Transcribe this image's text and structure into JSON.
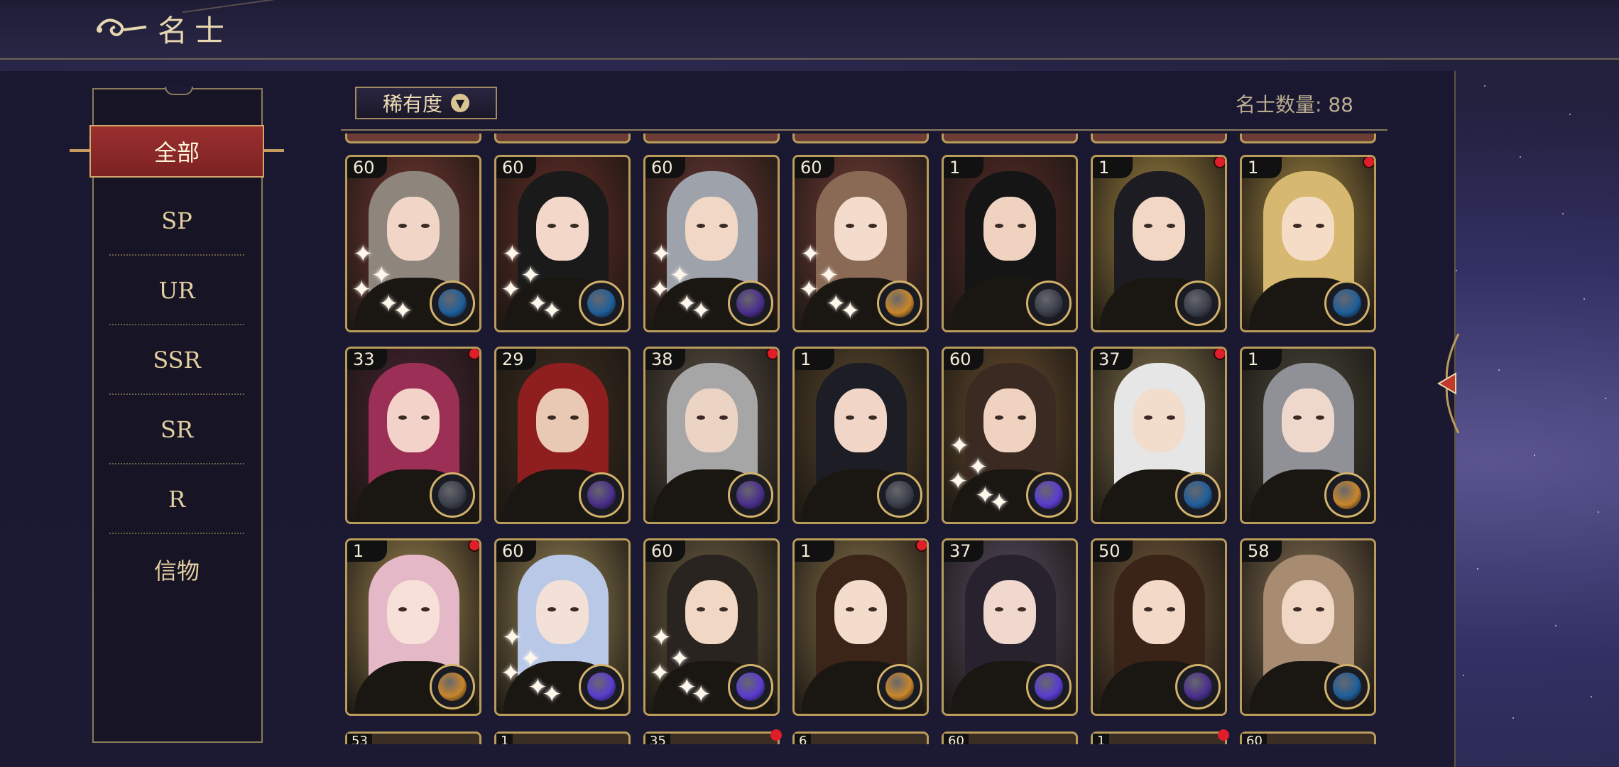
{
  "header": {
    "title": "名士"
  },
  "sidebar": {
    "tabs": [
      {
        "label": "全部",
        "active": true
      },
      {
        "label": "SP"
      },
      {
        "label": "UR"
      },
      {
        "label": "SSR"
      },
      {
        "label": "SR"
      },
      {
        "label": "R"
      },
      {
        "label": "信物"
      }
    ]
  },
  "toolbar": {
    "sort_label": "稀有度",
    "sort_icon": "chevron-down-icon",
    "count_text": "名士数量: 88"
  },
  "cards": [
    {
      "level": "60",
      "notify": false,
      "bg": "#7a3a34",
      "hair": "#8e857c",
      "skin": "#f1d6c8",
      "emblem": "#1f5f9a",
      "sparkles": true
    },
    {
      "level": "60",
      "notify": false,
      "bg": "#6b2f2a",
      "hair": "#1a1a1a",
      "skin": "#f3d8c9",
      "emblem": "#1f5f9a",
      "sparkles": true
    },
    {
      "level": "60",
      "notify": false,
      "bg": "#6e3a36",
      "hair": "#9ea3ab",
      "skin": "#f1d8c6",
      "emblem": "#4a2f8c",
      "sparkles": true
    },
    {
      "level": "60",
      "notify": false,
      "bg": "#7b403a",
      "hair": "#8a6a55",
      "skin": "#f4dccc",
      "emblem": "#c8862a",
      "sparkles": true
    },
    {
      "level": "1",
      "notify": false,
      "bg": "#5b2d2a",
      "hair": "#151515",
      "skin": "#efd2c0",
      "emblem": "#3a3f4a",
      "sparkles": false
    },
    {
      "level": "1",
      "notify": true,
      "bg": "#a68a45",
      "hair": "#1c1c22",
      "skin": "#f1d7c4",
      "emblem": "#3a3f4a",
      "sparkles": false
    },
    {
      "level": "1",
      "notify": true,
      "bg": "#a88c45",
      "hair": "#d6b870",
      "skin": "#f4dcc6",
      "emblem": "#1f5f9a",
      "sparkles": false
    },
    {
      "level": "33",
      "notify": true,
      "bg": "#4a2434",
      "hair": "#9c2f55",
      "skin": "#f3d3c9",
      "emblem": "#3a3f4a",
      "sparkles": false
    },
    {
      "level": "29",
      "notify": false,
      "bg": "#3f2f22",
      "hair": "#8f1f1f",
      "skin": "#e9c8b4",
      "emblem": "#4a2f8c",
      "sparkles": false
    },
    {
      "level": "38",
      "notify": true,
      "bg": "#5d5448",
      "hair": "#a6a6a6",
      "skin": "#ecd4c5",
      "emblem": "#4a2f8c",
      "sparkles": false
    },
    {
      "level": "1",
      "notify": false,
      "bg": "#5e4a2e",
      "hair": "#1d1d25",
      "skin": "#f1d6c8",
      "emblem": "#3a3f4a",
      "sparkles": false
    },
    {
      "level": "60",
      "notify": false,
      "bg": "#6c5030",
      "hair": "#3a2a22",
      "skin": "#f0d2c0",
      "emblem": "#5a3cd0",
      "sparkles": true
    },
    {
      "level": "37",
      "notify": true,
      "bg": "#8a7a52",
      "hair": "#e6e6e6",
      "skin": "#f2dccb",
      "emblem": "#1f5f9a",
      "sparkles": false
    },
    {
      "level": "1",
      "notify": false,
      "bg": "#4b4a3c",
      "hair": "#8f9196",
      "skin": "#eed8cb",
      "emblem": "#c8862a",
      "sparkles": false
    },
    {
      "level": "1",
      "notify": true,
      "bg": "#a48b55",
      "hair": "#e5b8c8",
      "skin": "#f6e0d8",
      "emblem": "#c8862a",
      "sparkles": false
    },
    {
      "level": "60",
      "notify": false,
      "bg": "#9b8858",
      "hair": "#b9c8e6",
      "skin": "#f3e0d6",
      "emblem": "#5a3cd0",
      "sparkles": true
    },
    {
      "level": "60",
      "notify": false,
      "bg": "#726346",
      "hair": "#2a2420",
      "skin": "#f0d8c4",
      "emblem": "#5a3cd0",
      "sparkles": true
    },
    {
      "level": "1",
      "notify": true,
      "bg": "#8c764c",
      "hair": "#3b2418",
      "skin": "#f4dccc",
      "emblem": "#c8862a",
      "sparkles": false
    },
    {
      "level": "37",
      "notify": false,
      "bg": "#5c5068",
      "hair": "#28222e",
      "skin": "#f0d8ce",
      "emblem": "#5a3cd0",
      "sparkles": false
    },
    {
      "level": "50",
      "notify": false,
      "bg": "#7a5e3e",
      "hair": "#3a2418",
      "skin": "#f3d9c8",
      "emblem": "#4a2f8c",
      "sparkles": false
    },
    {
      "level": "58",
      "notify": false,
      "bg": "#8c7658",
      "hair": "#a88c72",
      "skin": "#f1d8c6",
      "emblem": "#1f5f9a",
      "sparkles": false
    }
  ],
  "bottom_partial": [
    {
      "level": "53",
      "notify": false
    },
    {
      "level": "1",
      "notify": false
    },
    {
      "level": "35",
      "notify": true
    },
    {
      "level": "6",
      "notify": false
    },
    {
      "level": "60",
      "notify": false
    },
    {
      "level": "1",
      "notify": true
    },
    {
      "level": "60",
      "notify": false
    }
  ],
  "colors": {
    "accent_red": "#9b2f2f",
    "gold": "#b99c5c",
    "notify_red": "#e01e2a"
  }
}
